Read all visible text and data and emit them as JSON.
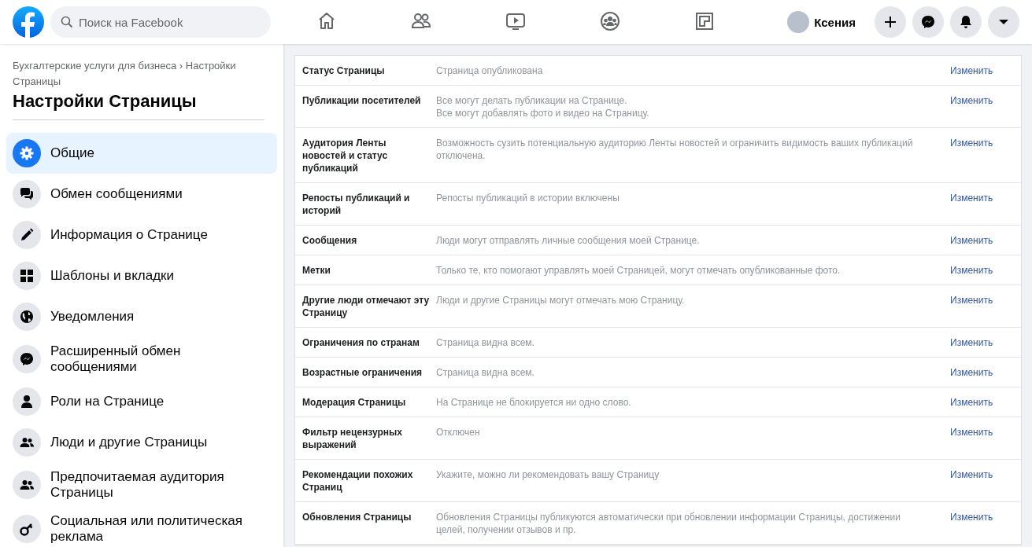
{
  "topbar": {
    "search": {
      "placeholder": "Поиск на Facebook"
    },
    "nav": [
      {
        "kind": "home",
        "selected": false
      },
      {
        "kind": "friends",
        "selected": false
      },
      {
        "kind": "watch",
        "selected": false
      },
      {
        "kind": "groups",
        "selected": false
      },
      {
        "kind": "gaming",
        "selected": false
      }
    ],
    "profile": {
      "name": "Ксения"
    },
    "actions": [
      {
        "kind": "plus"
      },
      {
        "kind": "messenger"
      },
      {
        "kind": "bell"
      },
      {
        "kind": "caret"
      }
    ]
  },
  "sidebar": {
    "breadcrumb": "Бухгалтерские услуги для бизнеса › Настройки Страницы",
    "title": "Настройки Страницы",
    "items": [
      {
        "label": "Общие",
        "kind": "gear",
        "selected": true
      },
      {
        "label": "Обмен сообщениями",
        "kind": "chat",
        "selected": false
      },
      {
        "label": "Информация о Странице",
        "kind": "pencil",
        "selected": false
      },
      {
        "label": "Шаблоны и вкладки",
        "kind": "grid",
        "selected": false
      },
      {
        "label": "Уведомления",
        "kind": "globe",
        "selected": false
      },
      {
        "label": "Расширенный обмен сообщениями",
        "kind": "messenger",
        "selected": false
      },
      {
        "label": "Роли на Странице",
        "kind": "person",
        "selected": false
      },
      {
        "label": "Люди и другие Страницы",
        "kind": "people",
        "selected": false
      },
      {
        "label": "Предпочитаемая аудитория Страницы",
        "kind": "people",
        "selected": false
      },
      {
        "label": "Социальная или политическая реклама",
        "kind": "key",
        "selected": false
      }
    ]
  },
  "settings": [
    {
      "label": "Статус Страницы",
      "value": [
        "Страница опубликована"
      ],
      "action": "Изменить"
    },
    {
      "label": "Публикации посетителей",
      "value": [
        "Все могут делать публикации на Странице.",
        "Все могут добавлять фото и видео на Страницу."
      ],
      "action": "Изменить"
    },
    {
      "label": "Аудитория Ленты новостей и статус публикаций",
      "value": [
        "Возможность сузить потенциальную аудиторию Ленты новостей и ограничить видимость ваших публикаций отключена."
      ],
      "action": "Изменить"
    },
    {
      "label": "Репосты публикаций и историй",
      "value": [
        "Репосты публикаций в истории включены"
      ],
      "action": "Изменить"
    },
    {
      "label": "Сообщения",
      "value": [
        "Люди могут отправлять личные сообщения моей Странице."
      ],
      "action": "Изменить"
    },
    {
      "label": "Метки",
      "value": [
        "Только те, кто помогают управлять моей Страницей, могут отмечать опубликованные фото."
      ],
      "action": "Изменить"
    },
    {
      "label": "Другие люди отмечают эту Страницу",
      "value": [
        "Люди и другие Страницы могут отмечать мою Страницу."
      ],
      "action": "Изменить"
    },
    {
      "label": "Ограничения по странам",
      "value": [
        "Страница видна всем."
      ],
      "action": "Изменить"
    },
    {
      "label": "Возрастные ограничения",
      "value": [
        "Страница видна всем."
      ],
      "action": "Изменить"
    },
    {
      "label": "Модерация Страницы",
      "value": [
        "На Странице не блокируется ни одно слово."
      ],
      "action": "Изменить"
    },
    {
      "label": "Фильтр нецензурных выражений",
      "value": [
        "Отключен"
      ],
      "action": "Изменить"
    },
    {
      "label": "Рекомендации похожих Страниц",
      "value": [
        "Укажите, можно ли рекомендовать вашу Страницу"
      ],
      "action": "Изменить"
    },
    {
      "label": "Обновления Страницы",
      "value": [
        "Обновления Страницы публикуются автоматически при обновлении информации Страницы, достижении целей, получении отзывов и пр."
      ],
      "action": "Изменить"
    }
  ]
}
